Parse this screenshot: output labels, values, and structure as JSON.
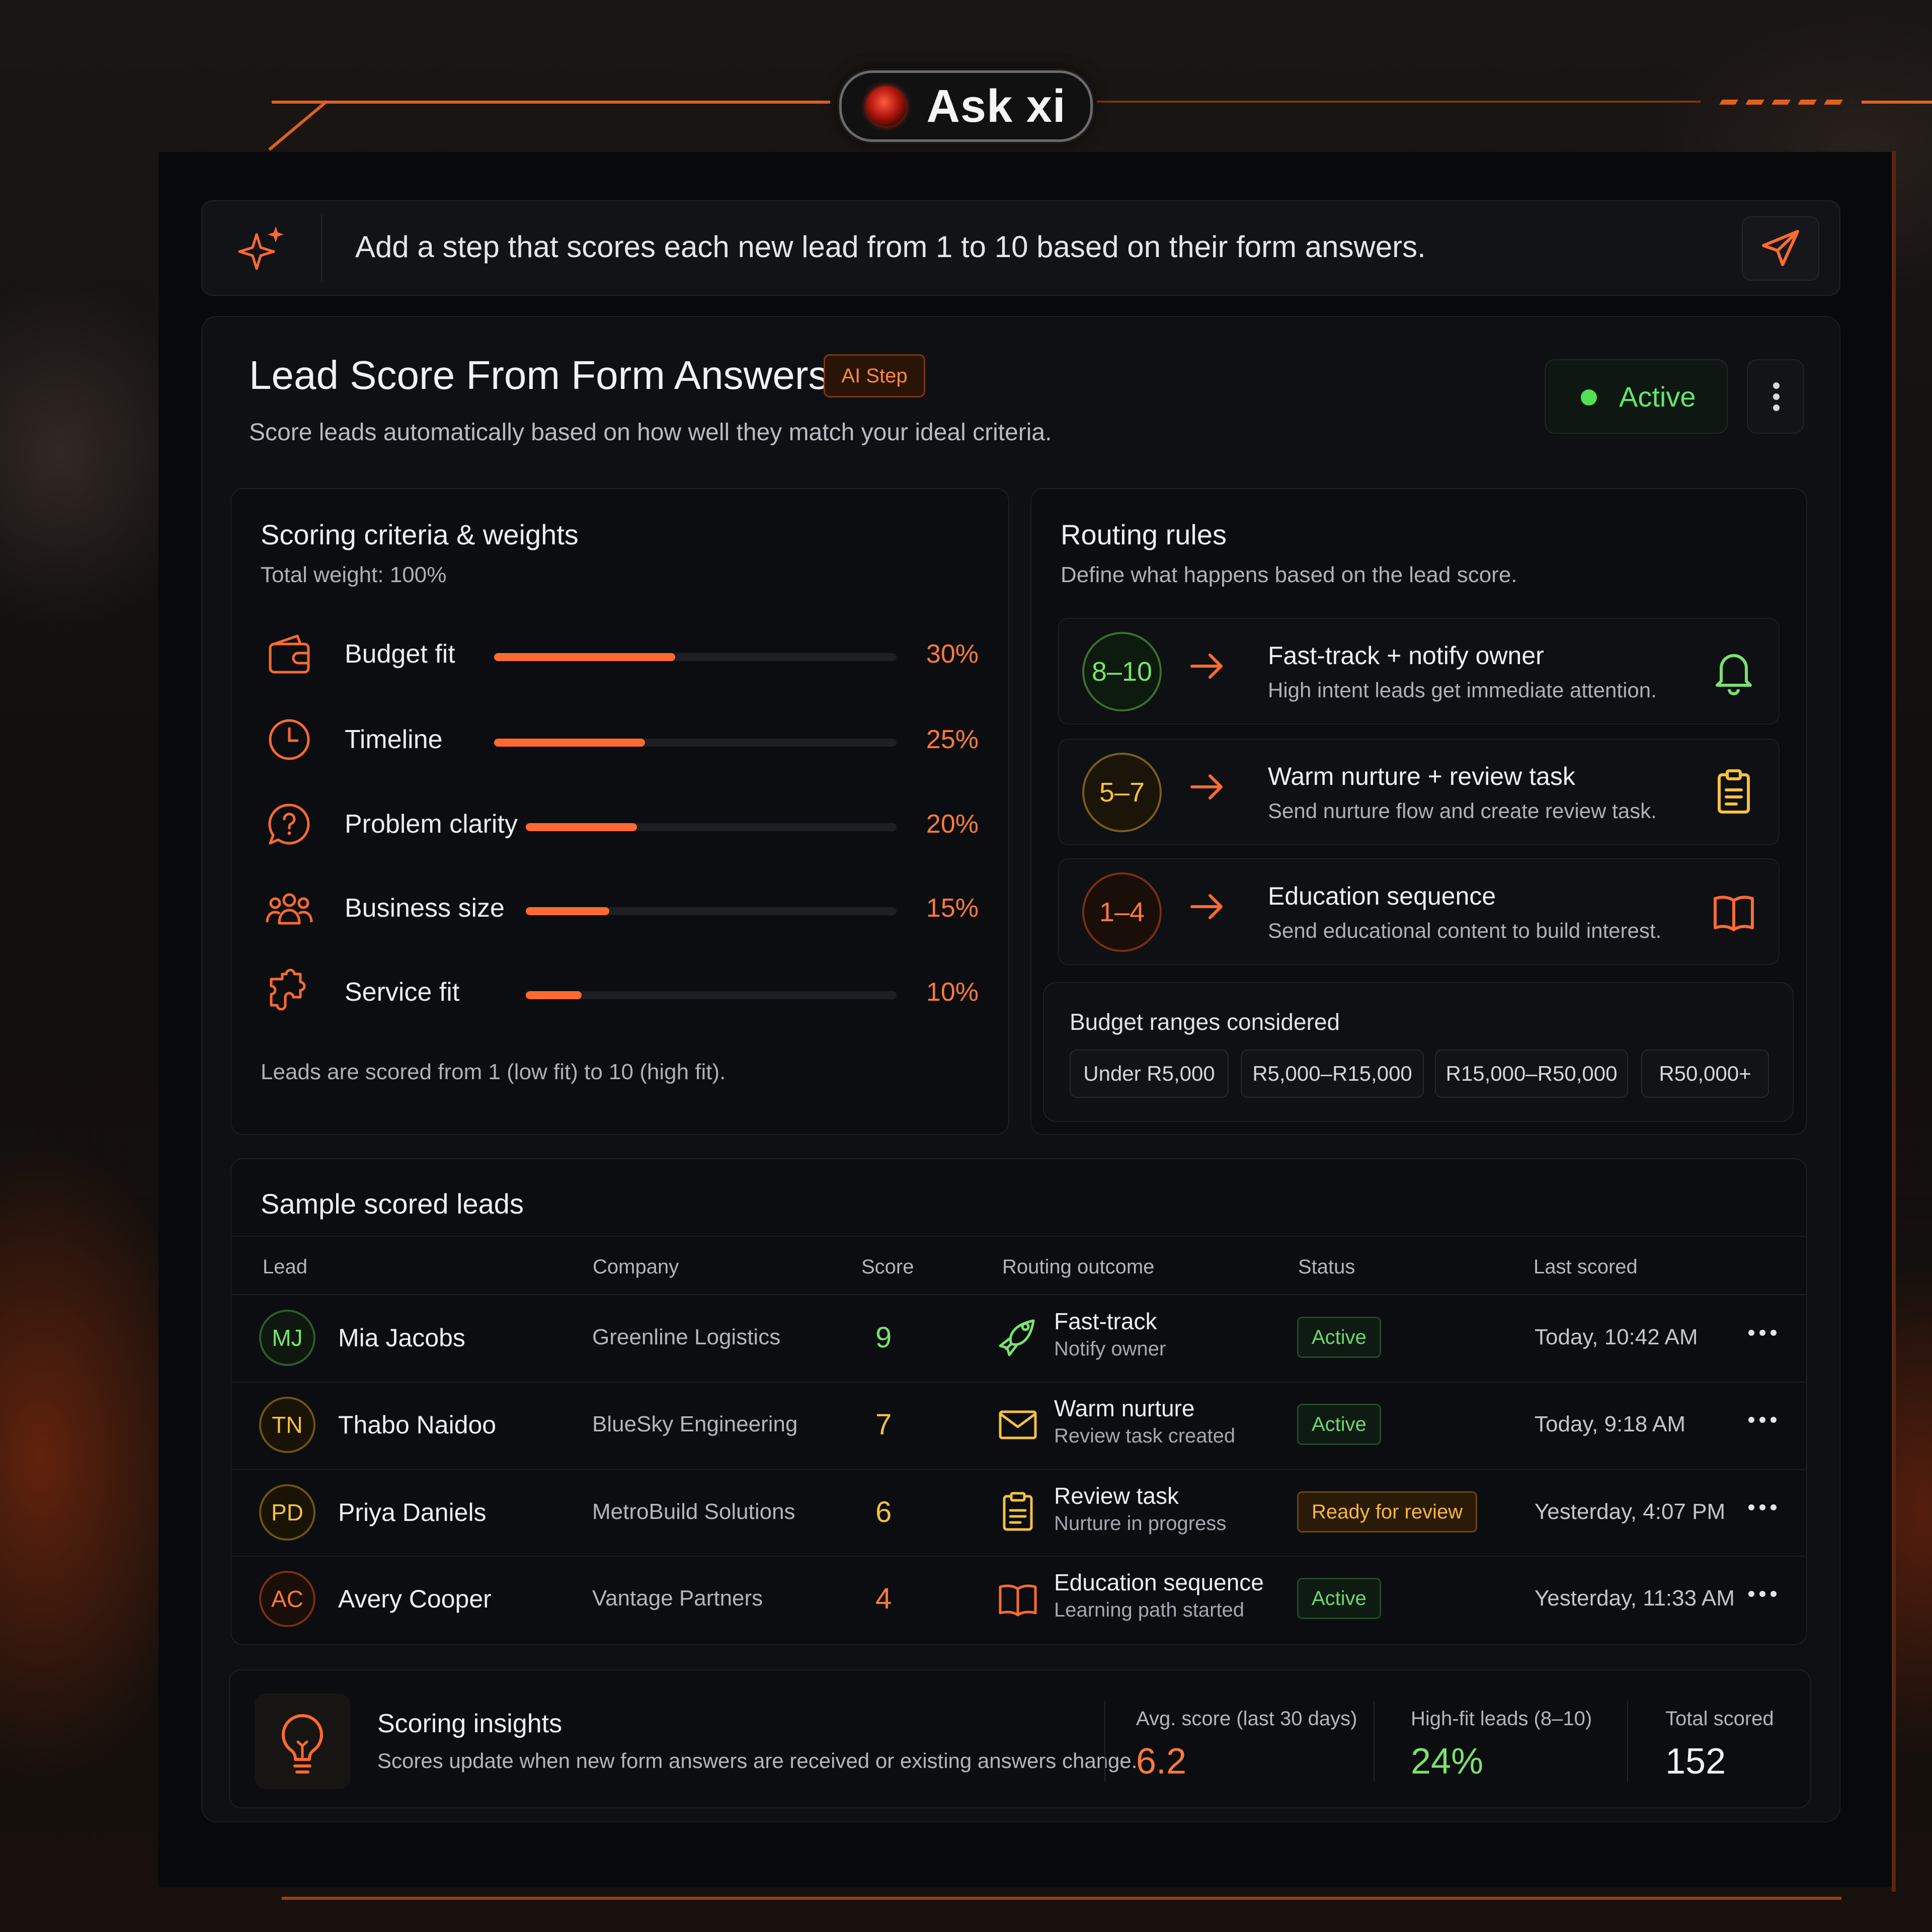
{
  "brand": {
    "name": "Ask xi"
  },
  "prompt": {
    "text": "Add a step that scores each new lead from 1 to 10 based on their form answers."
  },
  "step": {
    "title": "Lead Score From Form Answers",
    "badge": "AI Step",
    "subtitle": "Score leads automatically based on how well they match your ideal criteria.",
    "status": "Active",
    "status_color": "#54dd55"
  },
  "criteria": {
    "title": "Scoring criteria & weights",
    "total": "Total weight: 100%",
    "items": [
      {
        "name": "Budget fit",
        "weight": 30,
        "label": "30%",
        "icon": "wallet-icon"
      },
      {
        "name": "Timeline",
        "weight": 25,
        "label": "25%",
        "icon": "clock-icon"
      },
      {
        "name": "Problem clarity",
        "weight": 20,
        "label": "20%",
        "icon": "question-bubble-icon"
      },
      {
        "name": "Business size",
        "weight": 15,
        "label": "15%",
        "icon": "people-icon"
      },
      {
        "name": "Service fit",
        "weight": 10,
        "label": "10%",
        "icon": "puzzle-icon"
      }
    ],
    "footnote": "Leads are scored from 1 (low fit) to 10 (high fit).",
    "accent": "#ff6a30"
  },
  "routing": {
    "title": "Routing rules",
    "subtitle": "Define what happens based on the lead score.",
    "rules": [
      {
        "range": "8–10",
        "title": "Fast-track + notify owner",
        "desc": "High intent leads get immediate attention.",
        "icon": "bell-icon",
        "color": "#7be26f"
      },
      {
        "range": "5–7",
        "title": "Warm nurture + review task",
        "desc": "Send nurture flow and create review task.",
        "icon": "clipboard-icon",
        "color": "#f6c23e"
      },
      {
        "range": "1–4",
        "title": "Education sequence",
        "desc": "Send educational content to build interest.",
        "icon": "book-icon",
        "color": "#ff6a30"
      }
    ]
  },
  "budget": {
    "title": "Budget ranges considered",
    "ranges": [
      "Under R5,000",
      "R5,000–R15,000",
      "R15,000–R50,000",
      "R50,000+"
    ]
  },
  "table": {
    "title": "Sample scored leads",
    "headers": [
      "Lead",
      "Company",
      "Score",
      "Routing outcome",
      "Status",
      "Last scored"
    ],
    "rows": [
      {
        "initials": "MJ",
        "name": "Mia Jacobs",
        "company": "Greenline Logistics",
        "score": "9",
        "outcome": "Fast-track",
        "outcome_sub": "Notify owner",
        "outcome_icon": "rocket-icon",
        "status": "Active",
        "last": "Today, 10:42 AM",
        "color": "#7be26f"
      },
      {
        "initials": "TN",
        "name": "Thabo Naidoo",
        "company": "BlueSky Engineering",
        "score": "7",
        "outcome": "Warm nurture",
        "outcome_sub": "Review task created",
        "outcome_icon": "mail-icon",
        "status": "Active",
        "last": "Today, 9:18 AM",
        "color": "#f6c23e"
      },
      {
        "initials": "PD",
        "name": "Priya Daniels",
        "company": "MetroBuild Solutions",
        "score": "6",
        "outcome": "Review task",
        "outcome_sub": "Nurture in progress",
        "outcome_icon": "clipboard-icon",
        "status": "Ready for review",
        "last": "Yesterday, 4:07 PM",
        "color": "#f6c23e"
      },
      {
        "initials": "AC",
        "name": "Avery Cooper",
        "company": "Vantage Partners",
        "score": "4",
        "outcome": "Education sequence",
        "outcome_sub": "Learning path started",
        "outcome_icon": "book-icon",
        "status": "Active",
        "last": "Yesterday, 11:33 AM",
        "color": "#ff6a30"
      }
    ]
  },
  "insights": {
    "title": "Scoring insights",
    "desc": "Scores update when new form answers are received or existing answers change.",
    "metrics": [
      {
        "label": "Avg. score (last 30 days)",
        "value": "6.2",
        "color": "#ff7a3a"
      },
      {
        "label": "High-fit leads (8–10)",
        "value": "24%",
        "color": "#7be26f"
      },
      {
        "label": "Total scored",
        "value": "152",
        "color": "#f1f1f3"
      }
    ]
  }
}
